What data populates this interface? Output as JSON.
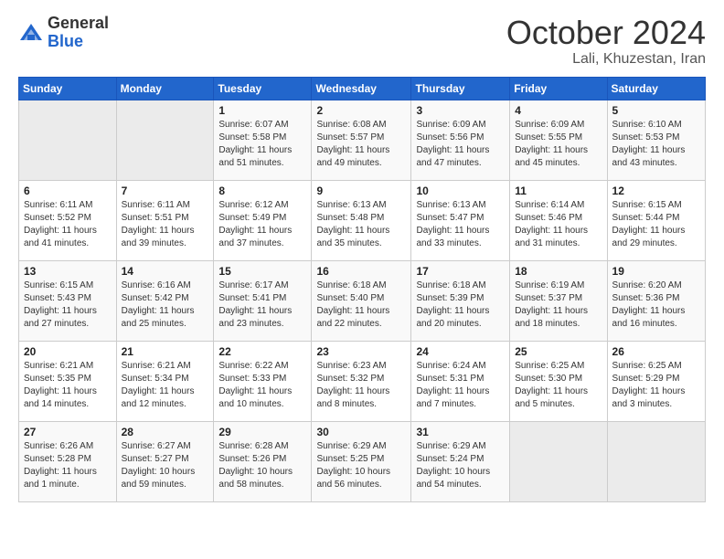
{
  "logo": {
    "general": "General",
    "blue": "Blue"
  },
  "title": {
    "month": "October 2024",
    "location": "Lali, Khuzestan, Iran"
  },
  "headers": [
    "Sunday",
    "Monday",
    "Tuesday",
    "Wednesday",
    "Thursday",
    "Friday",
    "Saturday"
  ],
  "weeks": [
    [
      {
        "day": "",
        "lines": []
      },
      {
        "day": "",
        "lines": []
      },
      {
        "day": "1",
        "lines": [
          "Sunrise: 6:07 AM",
          "Sunset: 5:58 PM",
          "Daylight: 11 hours",
          "and 51 minutes."
        ]
      },
      {
        "day": "2",
        "lines": [
          "Sunrise: 6:08 AM",
          "Sunset: 5:57 PM",
          "Daylight: 11 hours",
          "and 49 minutes."
        ]
      },
      {
        "day": "3",
        "lines": [
          "Sunrise: 6:09 AM",
          "Sunset: 5:56 PM",
          "Daylight: 11 hours",
          "and 47 minutes."
        ]
      },
      {
        "day": "4",
        "lines": [
          "Sunrise: 6:09 AM",
          "Sunset: 5:55 PM",
          "Daylight: 11 hours",
          "and 45 minutes."
        ]
      },
      {
        "day": "5",
        "lines": [
          "Sunrise: 6:10 AM",
          "Sunset: 5:53 PM",
          "Daylight: 11 hours",
          "and 43 minutes."
        ]
      }
    ],
    [
      {
        "day": "6",
        "lines": [
          "Sunrise: 6:11 AM",
          "Sunset: 5:52 PM",
          "Daylight: 11 hours",
          "and 41 minutes."
        ]
      },
      {
        "day": "7",
        "lines": [
          "Sunrise: 6:11 AM",
          "Sunset: 5:51 PM",
          "Daylight: 11 hours",
          "and 39 minutes."
        ]
      },
      {
        "day": "8",
        "lines": [
          "Sunrise: 6:12 AM",
          "Sunset: 5:49 PM",
          "Daylight: 11 hours",
          "and 37 minutes."
        ]
      },
      {
        "day": "9",
        "lines": [
          "Sunrise: 6:13 AM",
          "Sunset: 5:48 PM",
          "Daylight: 11 hours",
          "and 35 minutes."
        ]
      },
      {
        "day": "10",
        "lines": [
          "Sunrise: 6:13 AM",
          "Sunset: 5:47 PM",
          "Daylight: 11 hours",
          "and 33 minutes."
        ]
      },
      {
        "day": "11",
        "lines": [
          "Sunrise: 6:14 AM",
          "Sunset: 5:46 PM",
          "Daylight: 11 hours",
          "and 31 minutes."
        ]
      },
      {
        "day": "12",
        "lines": [
          "Sunrise: 6:15 AM",
          "Sunset: 5:44 PM",
          "Daylight: 11 hours",
          "and 29 minutes."
        ]
      }
    ],
    [
      {
        "day": "13",
        "lines": [
          "Sunrise: 6:15 AM",
          "Sunset: 5:43 PM",
          "Daylight: 11 hours",
          "and 27 minutes."
        ]
      },
      {
        "day": "14",
        "lines": [
          "Sunrise: 6:16 AM",
          "Sunset: 5:42 PM",
          "Daylight: 11 hours",
          "and 25 minutes."
        ]
      },
      {
        "day": "15",
        "lines": [
          "Sunrise: 6:17 AM",
          "Sunset: 5:41 PM",
          "Daylight: 11 hours",
          "and 23 minutes."
        ]
      },
      {
        "day": "16",
        "lines": [
          "Sunrise: 6:18 AM",
          "Sunset: 5:40 PM",
          "Daylight: 11 hours",
          "and 22 minutes."
        ]
      },
      {
        "day": "17",
        "lines": [
          "Sunrise: 6:18 AM",
          "Sunset: 5:39 PM",
          "Daylight: 11 hours",
          "and 20 minutes."
        ]
      },
      {
        "day": "18",
        "lines": [
          "Sunrise: 6:19 AM",
          "Sunset: 5:37 PM",
          "Daylight: 11 hours",
          "and 18 minutes."
        ]
      },
      {
        "day": "19",
        "lines": [
          "Sunrise: 6:20 AM",
          "Sunset: 5:36 PM",
          "Daylight: 11 hours",
          "and 16 minutes."
        ]
      }
    ],
    [
      {
        "day": "20",
        "lines": [
          "Sunrise: 6:21 AM",
          "Sunset: 5:35 PM",
          "Daylight: 11 hours",
          "and 14 minutes."
        ]
      },
      {
        "day": "21",
        "lines": [
          "Sunrise: 6:21 AM",
          "Sunset: 5:34 PM",
          "Daylight: 11 hours",
          "and 12 minutes."
        ]
      },
      {
        "day": "22",
        "lines": [
          "Sunrise: 6:22 AM",
          "Sunset: 5:33 PM",
          "Daylight: 11 hours",
          "and 10 minutes."
        ]
      },
      {
        "day": "23",
        "lines": [
          "Sunrise: 6:23 AM",
          "Sunset: 5:32 PM",
          "Daylight: 11 hours",
          "and 8 minutes."
        ]
      },
      {
        "day": "24",
        "lines": [
          "Sunrise: 6:24 AM",
          "Sunset: 5:31 PM",
          "Daylight: 11 hours",
          "and 7 minutes."
        ]
      },
      {
        "day": "25",
        "lines": [
          "Sunrise: 6:25 AM",
          "Sunset: 5:30 PM",
          "Daylight: 11 hours",
          "and 5 minutes."
        ]
      },
      {
        "day": "26",
        "lines": [
          "Sunrise: 6:25 AM",
          "Sunset: 5:29 PM",
          "Daylight: 11 hours",
          "and 3 minutes."
        ]
      }
    ],
    [
      {
        "day": "27",
        "lines": [
          "Sunrise: 6:26 AM",
          "Sunset: 5:28 PM",
          "Daylight: 11 hours",
          "and 1 minute."
        ]
      },
      {
        "day": "28",
        "lines": [
          "Sunrise: 6:27 AM",
          "Sunset: 5:27 PM",
          "Daylight: 10 hours",
          "and 59 minutes."
        ]
      },
      {
        "day": "29",
        "lines": [
          "Sunrise: 6:28 AM",
          "Sunset: 5:26 PM",
          "Daylight: 10 hours",
          "and 58 minutes."
        ]
      },
      {
        "day": "30",
        "lines": [
          "Sunrise: 6:29 AM",
          "Sunset: 5:25 PM",
          "Daylight: 10 hours",
          "and 56 minutes."
        ]
      },
      {
        "day": "31",
        "lines": [
          "Sunrise: 6:29 AM",
          "Sunset: 5:24 PM",
          "Daylight: 10 hours",
          "and 54 minutes."
        ]
      },
      {
        "day": "",
        "lines": []
      },
      {
        "day": "",
        "lines": []
      }
    ]
  ]
}
